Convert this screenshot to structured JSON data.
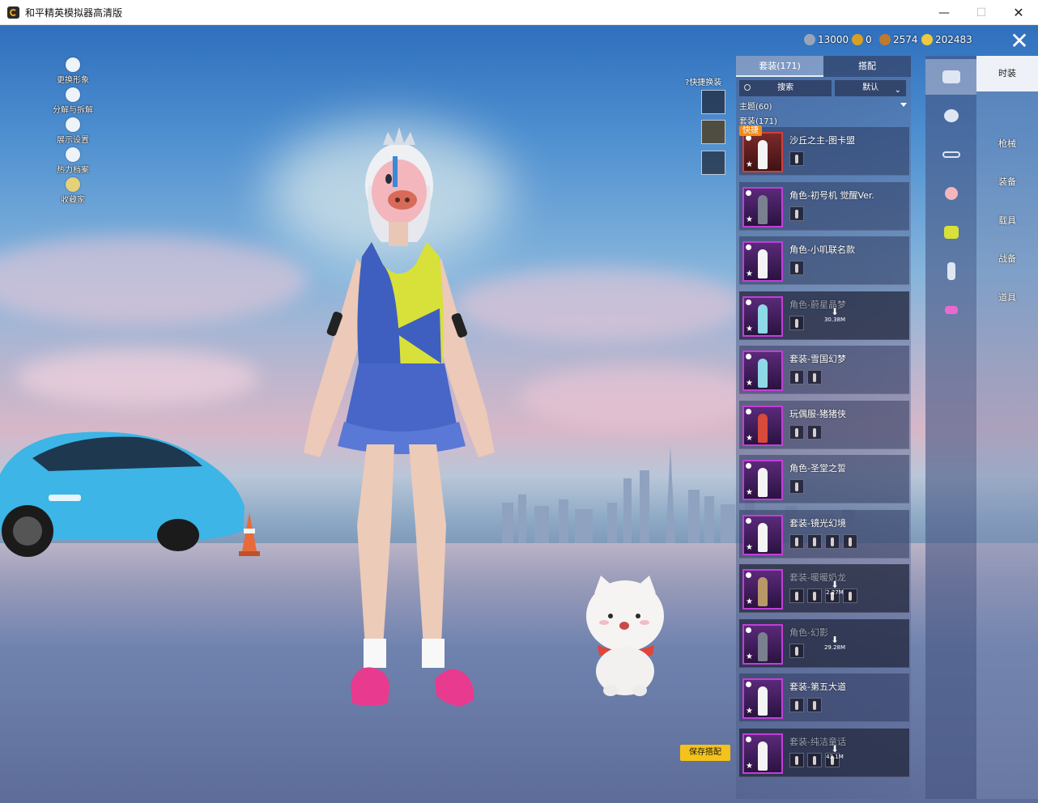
{
  "window": {
    "title": "和平精英模拟器高清版",
    "minimize_label": "—",
    "maximize_label": "☐",
    "close_label": "✕"
  },
  "left_menu": [
    {
      "label": "更换形象",
      "icon": "person-icon"
    },
    {
      "label": "分解与拆解",
      "icon": "puzzle-icon"
    },
    {
      "label": "展示设置",
      "icon": "eye-icon"
    },
    {
      "label": "热力档案",
      "icon": "flame-icon"
    },
    {
      "label": "收藏家",
      "icon": "collector-badge-icon"
    }
  ],
  "currencies": [
    {
      "value": "13000",
      "icon": "silver-coin-icon",
      "color": "#9aa4b8"
    },
    {
      "value": "0",
      "icon": "gold-token-icon",
      "color": "#d8a020"
    },
    {
      "value": "2574",
      "icon": "bronze-medal-icon",
      "color": "#c07a30"
    },
    {
      "value": "202483",
      "icon": "gold-coin-icon",
      "color": "#f0c840"
    }
  ],
  "close_label": "✕",
  "quick_swap": {
    "label": "快捷换装",
    "help_icon": "question-circle-icon"
  },
  "panel": {
    "tabs": [
      {
        "label": "套装(171)",
        "active": true
      },
      {
        "label": "搭配",
        "active": false
      }
    ],
    "search_placeholder": "搜索",
    "sort_label": "默认",
    "theme_line": "主题(60)",
    "set_line": "套装(171)",
    "quick_badge": "快捷",
    "items": [
      {
        "name": "沙丘之主-图卡盟",
        "rarity": "red",
        "figure": "white",
        "subs": 1,
        "dim": false
      },
      {
        "name": "角色-初号机 觉醒Ver.",
        "rarity": "purple",
        "figure": "dark",
        "subs": 1,
        "dim": false
      },
      {
        "name": "角色-小叽联名款",
        "rarity": "purple",
        "figure": "white",
        "subs": 1,
        "dim": false
      },
      {
        "name": "角色-蔚星晶梦",
        "rarity": "purple",
        "figure": "cyan",
        "subs": 1,
        "dim": true,
        "download": "30.38M"
      },
      {
        "name": "套装-雪国幻梦",
        "rarity": "purple",
        "figure": "cyan",
        "subs": 2,
        "dim": false
      },
      {
        "name": "玩偶服-猪猪侠",
        "rarity": "purple",
        "figure": "red",
        "subs": 2,
        "dim": false
      },
      {
        "name": "角色-圣堂之誓",
        "rarity": "purple",
        "figure": "white",
        "subs": 1,
        "dim": false
      },
      {
        "name": "套装-镜光幻境",
        "rarity": "purple",
        "figure": "white",
        "subs": 4,
        "dim": false
      },
      {
        "name": "套装-暖暖奶龙",
        "rarity": "purple",
        "figure": "tan",
        "subs": 4,
        "dim": true,
        "download": "2.27M"
      },
      {
        "name": "角色-幻影",
        "rarity": "purple",
        "figure": "dark",
        "subs": 1,
        "dim": true,
        "download": "29.28M"
      },
      {
        "name": "套装-第五大道",
        "rarity": "purple",
        "figure": "white",
        "subs": 2,
        "dim": false
      },
      {
        "name": "套装-纯洁童话",
        "rarity": "purple",
        "figure": "white",
        "subs": 3,
        "dim": true,
        "download": "43.1M"
      }
    ]
  },
  "rail_icons": [
    "outfit-hanger-icon",
    "helmet-icon",
    "goggles-icon",
    "mask-icon",
    "jacket-icon",
    "pants-icon",
    "shoes-icon"
  ],
  "categories": [
    "时装",
    "枪械",
    "装备",
    "载具",
    "战备",
    "道具"
  ],
  "save_button": "保存搭配",
  "accent": {
    "gold": "#f4c21a",
    "purple": "#c23ed8",
    "red": "#d43c3c",
    "orange": "#f08a1c"
  }
}
